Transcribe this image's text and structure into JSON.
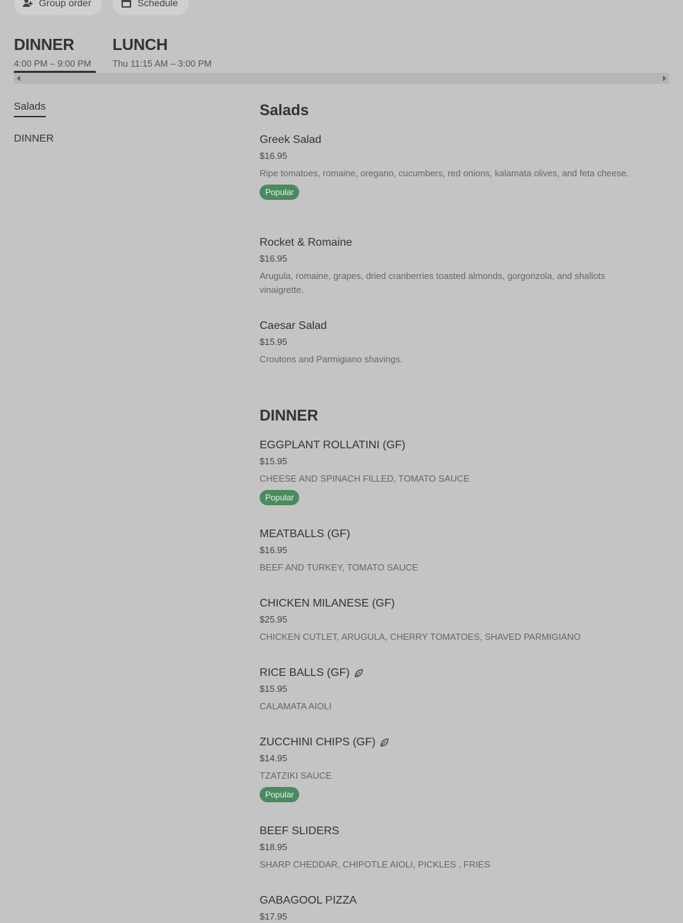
{
  "header": {
    "group_order_label": "Group order",
    "schedule_label": "Schedule"
  },
  "menus": [
    {
      "name": "DINNER",
      "hours": "4:00 PM – 9:00 PM",
      "selected": true
    },
    {
      "name": "LUNCH",
      "hours": "Thu 11:15 AM – 3:00 PM",
      "selected": false
    }
  ],
  "sidebar": {
    "items": [
      {
        "label": "Salads",
        "active": true
      },
      {
        "label": "DINNER",
        "active": false
      }
    ]
  },
  "sections": [
    {
      "title": "Salads",
      "items": [
        {
          "name": "Greek Salad",
          "price": "$16.95",
          "desc": "Ripe tomatoes, romaine, oregano, cucumbers, red onions, kalamata olives, and feta cheese.",
          "badge": "Popular"
        },
        {
          "name": "Rocket & Romaine",
          "price": "$16.95",
          "desc": "Arugula, romaine, grapes, dried cranberries toasted almonds, gorgonzola, and shallots vinaigrette."
        },
        {
          "name": "Caesar Salad",
          "price": "$15.95",
          "desc": "Croutons and Parmigiano shavings."
        }
      ]
    },
    {
      "title": "DINNER",
      "items": [
        {
          "name": "EGGPLANT ROLLATINI (GF)",
          "price": "$15.95",
          "desc": "CHEESE AND SPINACH FILLED, TOMATO SAUCE",
          "badge": "Popular"
        },
        {
          "name": "MEATBALLS (GF)",
          "price": "$16.95",
          "desc": "BEEF AND TURKEY, TOMATO SAUCE"
        },
        {
          "name": "CHICKEN MILANESE (GF)",
          "price": "$25.95",
          "desc": "CHICKEN CUTLET, ARUGULA, CHERRY TOMATOES, SHAVED PARMIGIANO"
        },
        {
          "name": "RICE BALLS (GF)",
          "price": "$15.95",
          "desc": "CALAMATA AIOLI",
          "icon": "leaf-icon"
        },
        {
          "name": "ZUCCHINI CHIPS (GF)",
          "price": "$14.95",
          "desc": "TZATZIKI SAUCE",
          "icon": "leaf-icon",
          "badge": "Popular"
        },
        {
          "name": "BEEF SLIDERS",
          "price": "$18.95",
          "desc": "SHARP CHEDDAR, CHIPOTLE AIOLI, PICKLES , FRIES"
        },
        {
          "name": "GABAGOOL PIZZA",
          "price": "$17.95"
        }
      ]
    }
  ],
  "colors": {
    "background": "#c4c4c4",
    "popular_badge": "#4b8a5e",
    "text": "#333333"
  }
}
